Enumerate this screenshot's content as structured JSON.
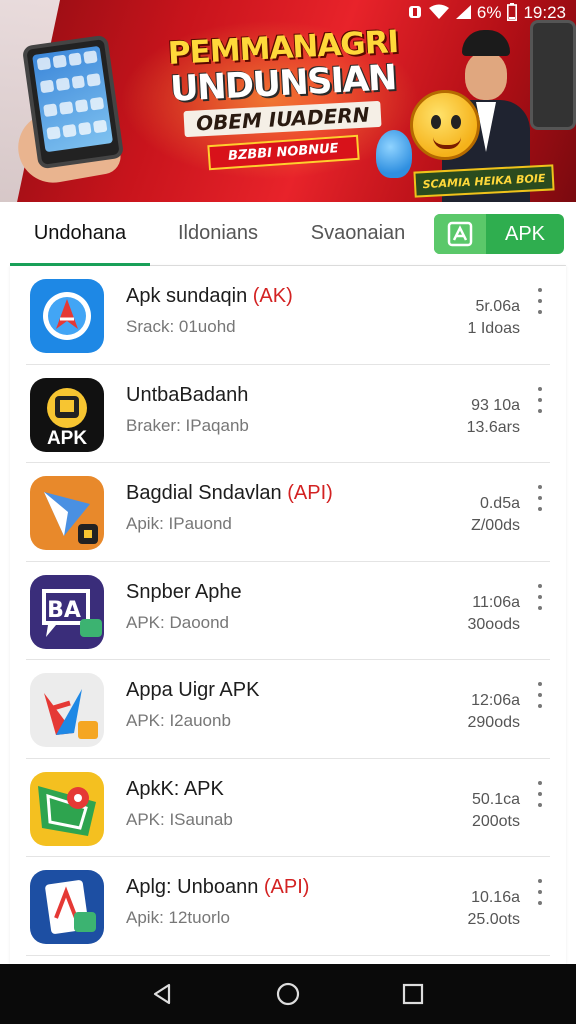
{
  "status_bar": {
    "battery": "6%",
    "time": "19:23",
    "icons": [
      "notification-icon",
      "wifi-icon",
      "signal-icon",
      "battery-icon"
    ]
  },
  "banner": {
    "line1": "PEMMANAGRI",
    "line2": "UNDUNSIAN",
    "line3": "OBEM IUADERN",
    "line4": "BZBBI NOBNUE",
    "sign": "SCAMIA HEIKA BOIE"
  },
  "tabs": [
    {
      "label": "Undohana",
      "active": true
    },
    {
      "label": "Ildonians",
      "active": false
    },
    {
      "label": "Svaonaian",
      "active": false
    }
  ],
  "apk_button": {
    "label": "APK",
    "icon": "apk-download-icon"
  },
  "apps": [
    {
      "name": "Apk sundaqin",
      "tag": "(AK)",
      "sub": "Srack: 01uohd",
      "meta1": "5r.06a",
      "meta2": "1 Idoas",
      "icon": "compass-a-icon"
    },
    {
      "name": "UntbaBadanh",
      "tag": "",
      "sub": "Braker: IPaqanb",
      "meta1": "93 10a",
      "meta2": "13.6ars",
      "icon": "apk-robot-icon"
    },
    {
      "name": "Bagdial Sndavlan",
      "tag": "(API)",
      "sub": "Apik: IPauond",
      "meta1": "0.d5a",
      "meta2": "Z/00ds",
      "icon": "paper-plane-icon"
    },
    {
      "name": "Snpber Aphe",
      "tag": "",
      "sub": "APK: Daoond",
      "meta1": "11:06a",
      "meta2": "30oods",
      "icon": "chat-ba-icon"
    },
    {
      "name": "Appa Uigr APK",
      "tag": "",
      "sub": "APK: I2auonb",
      "meta1": "12:06a",
      "meta2": "290ods",
      "icon": "star-arrow-icon"
    },
    {
      "name": "ApkK: APK",
      "tag": "",
      "sub": "APK: ISaunab",
      "meta1": "50.1ca",
      "meta2": "200ots",
      "icon": "map-pin-icon"
    },
    {
      "name": "Aplg: Unboann",
      "tag": "(API)",
      "sub": "Apik: 12tuorlo",
      "meta1": "10.16a",
      "meta2": "25.0ots",
      "icon": "document-a-icon"
    }
  ],
  "nav": {
    "back": "back-icon",
    "home": "home-icon",
    "recents": "recents-icon"
  }
}
